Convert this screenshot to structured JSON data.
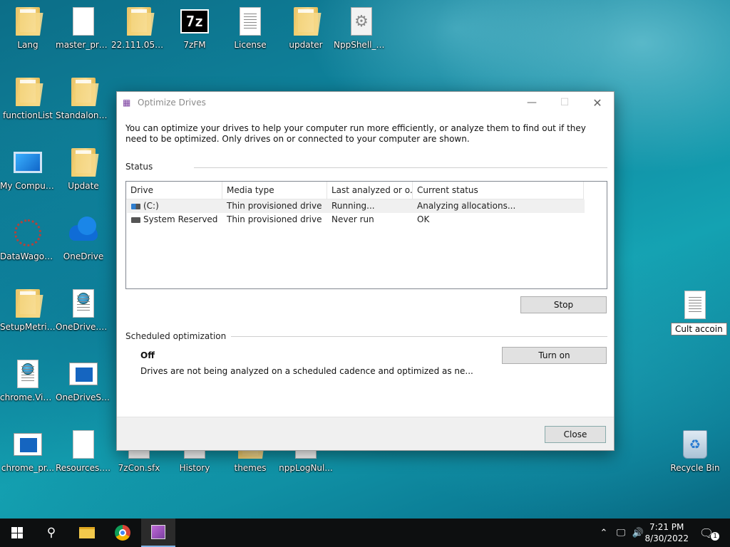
{
  "desktop": {
    "icons": [
      {
        "label": "Lang",
        "type": "folder"
      },
      {
        "label": "master_pref...",
        "type": "doc"
      },
      {
        "label": "22.111.0522...",
        "type": "folder"
      },
      {
        "label": "7zFM",
        "type": "7z"
      },
      {
        "label": "License",
        "type": "doclines"
      },
      {
        "label": "updater",
        "type": "folder"
      },
      {
        "label": "NppShell_0...",
        "type": "gear"
      },
      {
        "label": "functionList",
        "type": "folder"
      },
      {
        "label": "Standalone...",
        "type": "folder"
      },
      {
        "label": "My Computer",
        "type": "monitor"
      },
      {
        "label": "Update",
        "type": "folder"
      },
      {
        "label": "DataWagon...",
        "type": "virus"
      },
      {
        "label": "OneDrive",
        "type": "cloud"
      },
      {
        "label": "SetupMetrics",
        "type": "folder"
      },
      {
        "label": "OneDrive.Vi...",
        "type": "globe"
      },
      {
        "label": "chrome.Vis...",
        "type": "globe"
      },
      {
        "label": "OneDriveSta...",
        "type": "bluewin"
      },
      {
        "label": "chrome_pr...",
        "type": "bluewin"
      },
      {
        "label": "Resources.pri",
        "type": "doc"
      },
      {
        "label": "7zCon.sfx",
        "type": "doc"
      },
      {
        "label": "History",
        "type": "doc"
      },
      {
        "label": "themes",
        "type": "folder"
      },
      {
        "label": "nppLogNul...",
        "type": "doc"
      },
      {
        "label": "Cult accoin",
        "type": "doclines"
      },
      {
        "label": "Recycle Bin",
        "type": "bin"
      }
    ]
  },
  "dialog": {
    "title": "Optimize Drives",
    "description": "You can optimize your drives to help your computer run more efficiently, or analyze them to find out if they need to be optimized. Only drives on or connected to your computer are shown.",
    "status_section": "Status",
    "columns": [
      "Drive",
      "Media type",
      "Last analyzed or o...",
      "Current status"
    ],
    "drives": [
      {
        "drive": "(C:)",
        "media": "Thin provisioned drive",
        "last": "Running...",
        "status": "Analyzing allocations..."
      },
      {
        "drive": "System Reserved",
        "media": "Thin provisioned drive",
        "last": "Never run",
        "status": "OK"
      }
    ],
    "stop_label": "Stop",
    "scheduled_section": "Scheduled optimization",
    "scheduled_state": "Off",
    "scheduled_desc": "Drives are not being analyzed on a scheduled cadence and optimized as ne...",
    "turn_on_label": "Turn on",
    "close_label": "Close"
  },
  "taskbar": {
    "time": "7:21 PM",
    "date": "8/30/2022",
    "notification_count": "1"
  }
}
